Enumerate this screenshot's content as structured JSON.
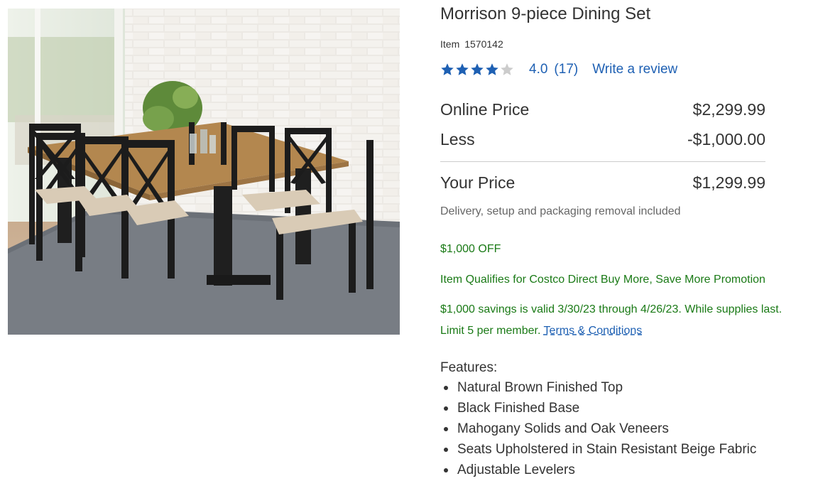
{
  "product": {
    "image_alt": "Morrison 9-piece Dining Set",
    "title": "Morrison 9-piece Dining Set",
    "item_label": "Item",
    "item_number": "1570142"
  },
  "rating": {
    "value": "4.0",
    "stars_filled": 4,
    "stars_total": 5,
    "review_count": "(17)",
    "write_review": "Write a review"
  },
  "pricing": {
    "online_label": "Online Price",
    "online_value": "$2,299.99",
    "less_label": "Less",
    "less_value": "-$1,000.00",
    "your_label": "Your Price",
    "your_value": "$1,299.99",
    "delivery_note": "Delivery, setup and packaging removal included"
  },
  "promotion": {
    "off": "$1,000 OFF",
    "qualifies": "Item Qualifies for Costco Direct Buy More, Save More Promotion",
    "valid": "$1,000 savings is valid 3/30/23 through 4/26/23. While supplies last.",
    "limit": "Limit 5 per member.",
    "terms_link": "Terms & Conditions"
  },
  "features": {
    "heading": "Features:",
    "items": [
      "Natural Brown Finished Top",
      "Black Finished Base",
      "Mahogany Solids and Oak Veneers",
      "Seats Upholstered in Stain Resistant Beige Fabric",
      "Adjustable Levelers"
    ]
  },
  "colors": {
    "link": "#1e60b3",
    "promo_green": "#1a7a16",
    "star_filled": "#1e60b3",
    "star_empty": "#cccccc",
    "text": "#333333"
  },
  "icons": {
    "star": "star-icon"
  }
}
